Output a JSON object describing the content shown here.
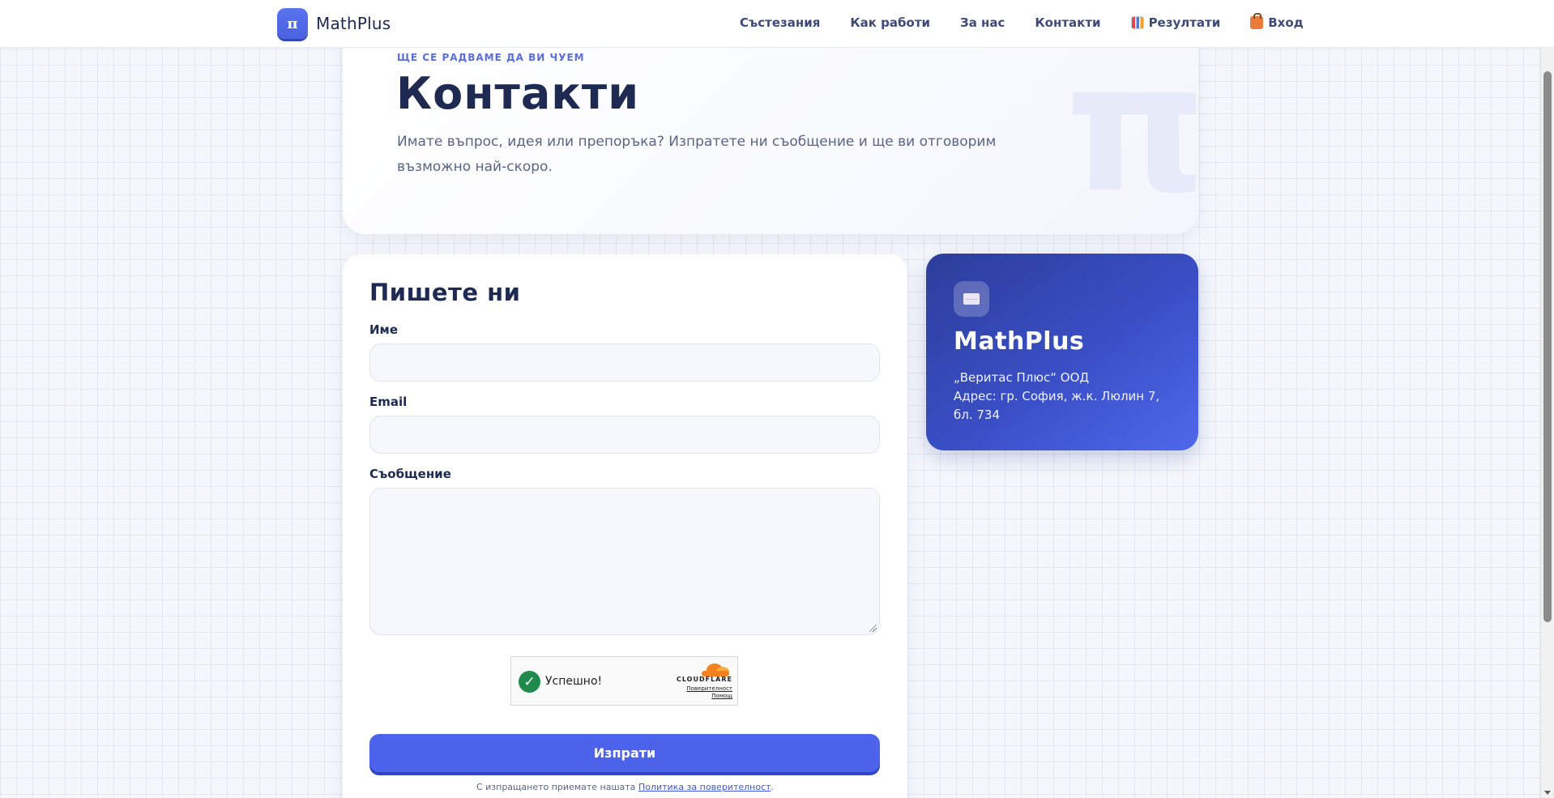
{
  "header": {
    "brand_icon": "π",
    "brand_name": "MathPlus",
    "nav": [
      {
        "label": "Състезания",
        "icon": ""
      },
      {
        "label": "Как работи",
        "icon": ""
      },
      {
        "label": "За нас",
        "icon": ""
      },
      {
        "label": "Контакти",
        "icon": ""
      },
      {
        "label": "Резултати",
        "icon": "bar-chart-icon"
      },
      {
        "label": "Вход",
        "icon": "shopping-bag-icon"
      }
    ]
  },
  "hero": {
    "eyebrow": "ЩЕ СЕ РАДВАМЕ ДА ВИ ЧУЕМ",
    "title": "Контакти",
    "description": "Имате въпрос, идея или препоръка? Изпратете ни съобщение и ще ви отговорим възможно най-скоро.",
    "decor_symbol": "π"
  },
  "form": {
    "title": "Пишете ни",
    "fields": {
      "name": {
        "label": "Име",
        "value": "",
        "placeholder": ""
      },
      "email": {
        "label": "Email",
        "value": "",
        "placeholder": ""
      },
      "message": {
        "label": "Съобщение",
        "value": "",
        "placeholder": ""
      }
    },
    "captcha": {
      "status": "Успешно!",
      "provider": "CLOUDFLARE",
      "privacy_link": "Поверителност",
      "help_link": "Помощ"
    },
    "submit_label": "Изпрати",
    "consent_prefix": "С изпращането приемате нашата",
    "consent_link": "Политика за поверителност",
    "consent_suffix": "."
  },
  "info": {
    "icon": "envelope-icon",
    "title": "MathPlus",
    "company": "„Веритас Плюс“ ООД",
    "address": "Адрес: гр. София, ж.к. Люлин 7, бл. 734"
  },
  "colors": {
    "accent": "#4d63ec",
    "info_card_dark": "#2c3d9a",
    "info_card_light": "#4f68ec",
    "heading": "#1e2a52",
    "captcha_success": "#1f8a4c"
  }
}
